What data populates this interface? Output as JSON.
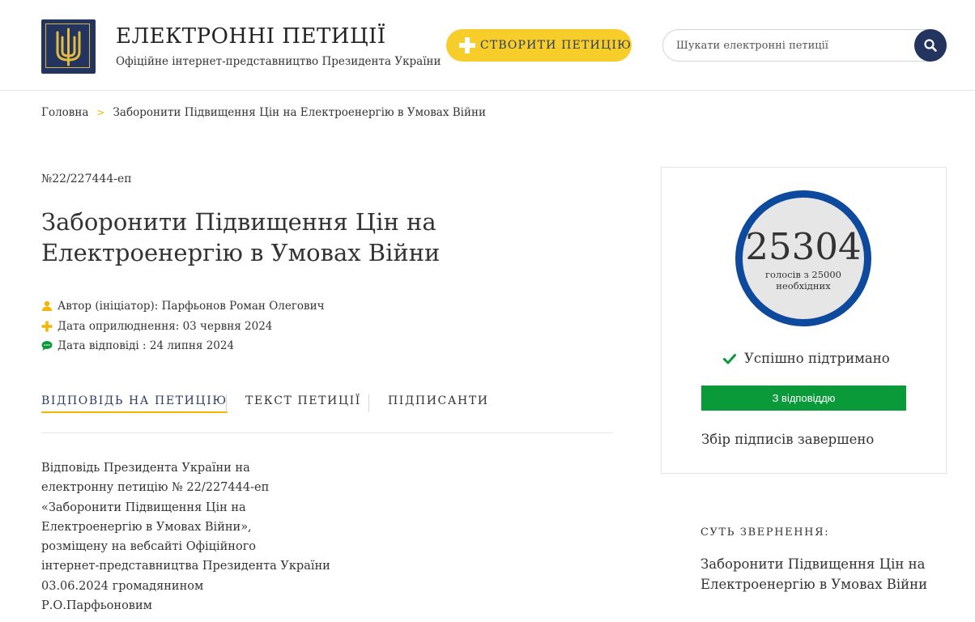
{
  "header": {
    "site_title": "ЕЛЕКТРОННІ ПЕТИЦІЇ",
    "site_subtitle": "Офіційне інтернет-представництво Президента України",
    "create_button": "СТВОРИТИ ПЕТИЦІЮ",
    "search_placeholder": "Шукати електронні петиції"
  },
  "breadcrumb": {
    "home": "Головна",
    "separator": ">",
    "current": "Заборонити Підвищення Цін на Електроенергію в Умовах Війни"
  },
  "petition": {
    "number": "№22/227444-еп",
    "title": "Заборонити Підвищення Цін на Електроенергію в Умовах Війни",
    "author": "Автор (ініціатор): Парфьонов Роман Олегович",
    "published": "Дата оприлюднення: 03 червня 2024",
    "answered": "Дата відповіді : 24 липня 2024"
  },
  "tabs": [
    "ВІДПОВІДЬ НА ПЕТИЦІЮ",
    "ТЕКСТ ПЕТИЦІЇ",
    "ПІДПИСАНТИ"
  ],
  "answer_lines": [
    "Відповідь Президента України на",
    "електронну петицію № 22/227444-еп",
    "«Заборонити Підвищення Цін на",
    "Електроенергію в Умовах Війни»,",
    "розміщену на вебсайті Офіційного",
    "інтернет-представництва Президента України",
    "03.06.2024 громадянином",
    "Р.О.Парфьоновим"
  ],
  "votes": {
    "count": "25304",
    "sub_line1": "голосів з 25000",
    "sub_line2": "необхідних",
    "status": "Успішно підтримано",
    "reply_button": "З відповіддю",
    "collection": "Збір підписів завершено"
  },
  "essence": {
    "label": "СУТЬ ЗВЕРНЕННЯ:",
    "text": "Заборонити Підвищення Цін на Електроенергію в Умовах Війни"
  },
  "colors": {
    "brand_navy": "#23355f",
    "accent_yellow": "#f7cd2a",
    "vote_ring_blue": "#0d4a9e",
    "success_green": "#0a9a3a"
  }
}
